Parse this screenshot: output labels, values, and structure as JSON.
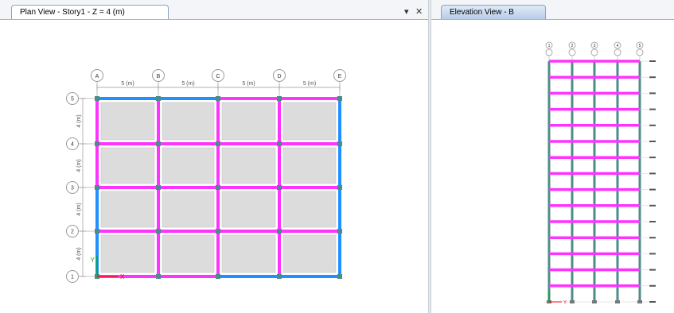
{
  "plan_view": {
    "tab_title": "Plan View - Story1 - Z = 4 (m)",
    "dropdown_glyph": "▾",
    "close_glyph": "✕",
    "grid_x_labels": [
      "A",
      "B",
      "C",
      "D",
      "E"
    ],
    "grid_y_labels": [
      "5",
      "4",
      "3",
      "2",
      "1"
    ],
    "span_x_labels": [
      "5 (m)",
      "5 (m)",
      "5 (m)",
      "5 (m)"
    ],
    "span_y_labels": [
      "4 (m)",
      "4 (m)",
      "4 (m)",
      "4 (m)"
    ],
    "axis_x_label": "X",
    "axis_y_label": "Y"
  },
  "elevation_view": {
    "tab_title": "Elevation View - B",
    "grid_labels": [
      "1",
      "2",
      "3",
      "4",
      "5"
    ],
    "story_count": 15,
    "axis_label": "Y"
  },
  "colors": {
    "beam_magenta": "#ff33ff",
    "beam_blue": "#1e90ff",
    "column_teal": "#4d8c8c",
    "slab_gray": "#dcdcdc",
    "grid_line_gray": "#b0b0b0",
    "axis_red": "#ff0000",
    "axis_green": "#00b000"
  }
}
